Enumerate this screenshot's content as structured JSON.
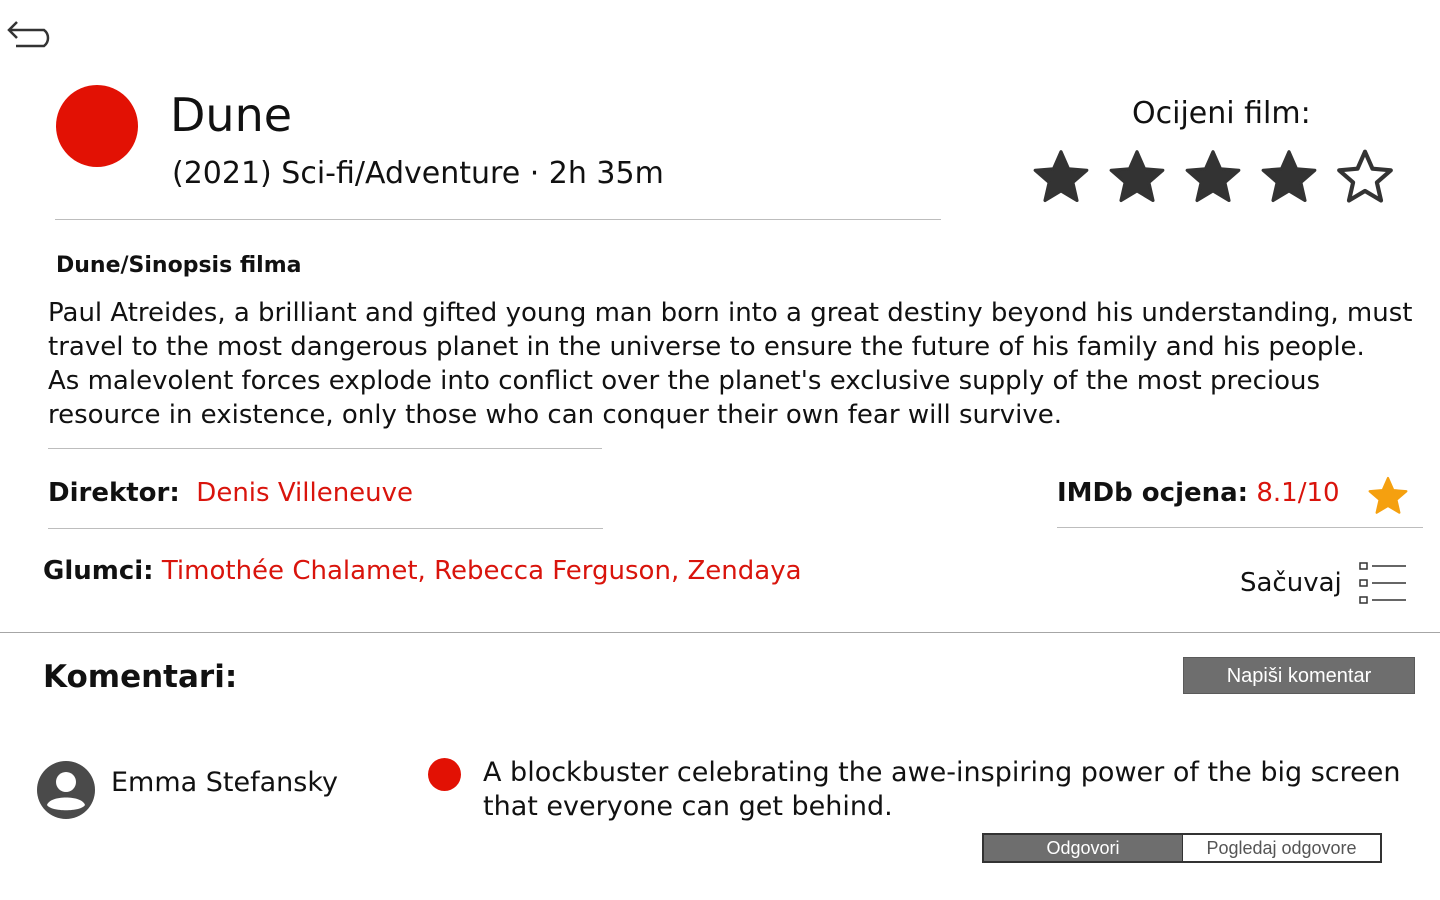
{
  "nav": {
    "back_icon": "back-arrow-icon"
  },
  "movie": {
    "title": "Dune",
    "meta": "(2021) Sci-fi/Adventure · 2h 35m",
    "poster_color": "#e21104"
  },
  "rating": {
    "label": "Ocijeni film:",
    "user_stars": 4,
    "max_stars": 5,
    "star_color": "#333333"
  },
  "synopsis": {
    "heading": "Dune/Sinopsis filma",
    "paragraphs": [
      "Paul Atreides, a brilliant and gifted young man born into a great destiny beyond his understanding, must travel to the most dangerous planet in the universe to ensure the future of his family and his people.",
      "As malevolent forces explode into conflict over the planet's exclusive supply of the most precious resource in existence, only those who can conquer their own fear will survive."
    ]
  },
  "details": {
    "director_label": "Direktor:",
    "director_value": "Denis Villeneuve",
    "imdb_label": "IMDb ocjena:",
    "imdb_value": "8.1/10",
    "imdb_star_color": "#f5a00f",
    "cast_label": "Glumci:",
    "cast_value": "Timothée Chalamet, Rebecca Ferguson, Zendaya",
    "accent_color": "#d9140c"
  },
  "save": {
    "label": "Sačuvaj",
    "icon": "checklist-icon"
  },
  "comments": {
    "title": "Komentari:",
    "write_button": "Napiši komentar",
    "items": [
      {
        "user": "Emma Stefansky",
        "avatar_icon": "user-avatar-icon",
        "text": "A blockbuster celebrating the awe-inspiring power of the big screen that everyone can get behind.",
        "reply_button": "Odgovori",
        "view_replies_button": "Pogledaj odgovore"
      }
    ]
  }
}
